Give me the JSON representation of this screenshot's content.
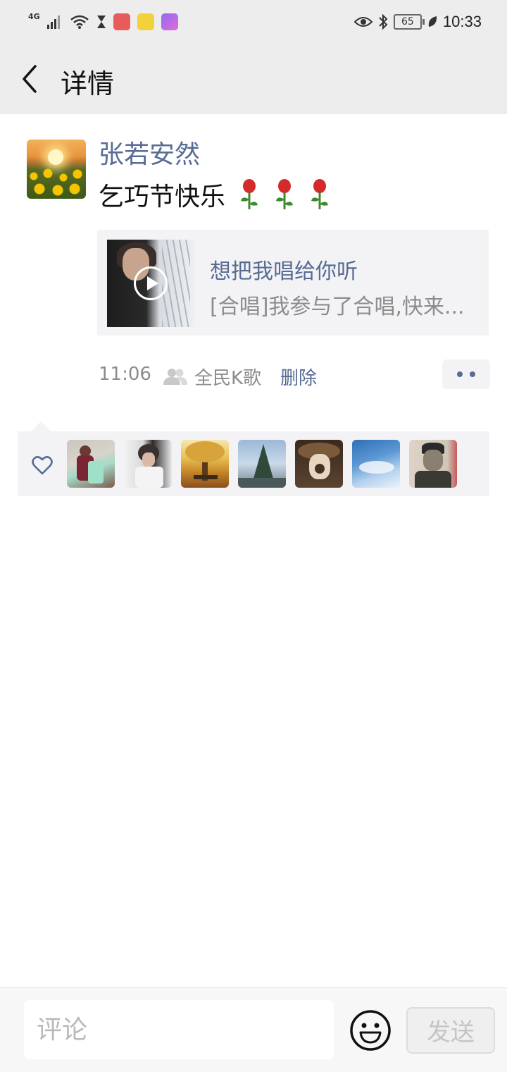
{
  "status_bar": {
    "network": "4G",
    "battery": "65",
    "time": "10:33"
  },
  "nav": {
    "title": "详情"
  },
  "post": {
    "username": "张若安然",
    "text": "乞巧节快乐",
    "share": {
      "title": "想把我唱给你听",
      "description": "[合唱]我参与了合唱,快来..."
    },
    "time": "11:06",
    "source": "全民K歌",
    "delete_label": "删除"
  },
  "likes": {
    "count_shown": 7,
    "avatars": [
      "avatar-1",
      "avatar-2",
      "avatar-3",
      "avatar-4",
      "avatar-5",
      "avatar-6",
      "avatar-7"
    ]
  },
  "comment_bar": {
    "placeholder": "评论",
    "send_label": "发送"
  },
  "colors": {
    "link_blue": "#576b95",
    "gray_text": "#8c8c8c",
    "header_bg": "#ededed",
    "card_bg": "#f3f3f5"
  }
}
